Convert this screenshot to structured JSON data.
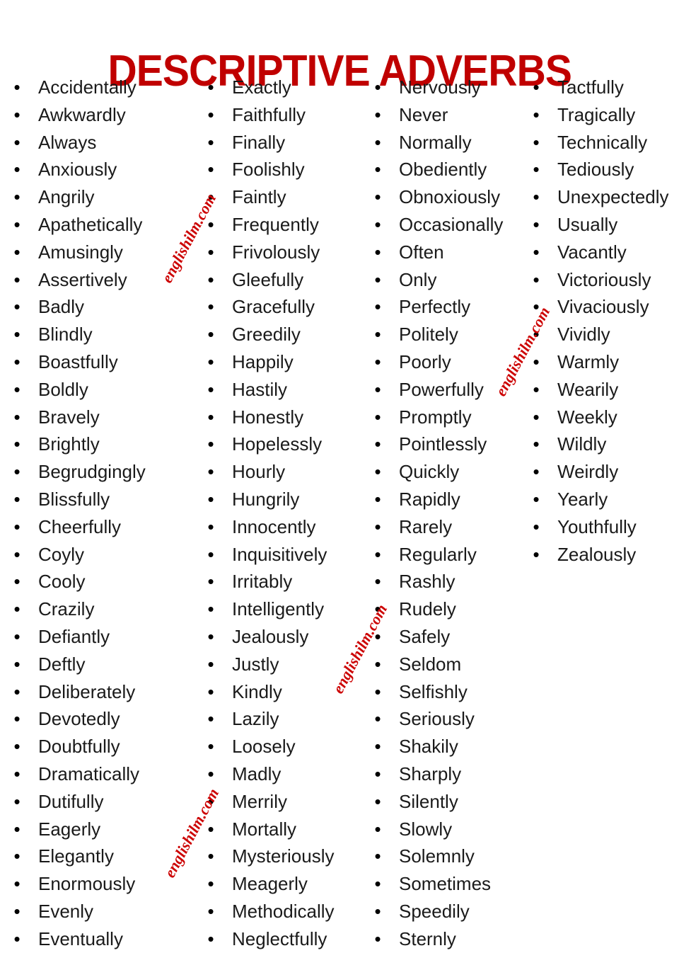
{
  "page": {
    "title": "DESCRIPTIVE ADVERBS",
    "title_color": "#C00000",
    "background_color": "#FFFFFF",
    "text_color": "#1A1A1A",
    "bullet_glyph": "•"
  },
  "watermarks": [
    {
      "text": "englishilm.com",
      "color": "#CC0000"
    },
    {
      "text": "englishilm.com",
      "color": "#CC0000"
    },
    {
      "text": "englishilm.com",
      "color": "#CC0000"
    },
    {
      "text": "englishilm.com",
      "color": "#CC0000"
    }
  ],
  "columns": [
    {
      "id": "column-1",
      "items": [
        "Accidentally",
        "Awkwardly",
        "Always",
        "Anxiously",
        "Angrily",
        "Apathetically",
        "Amusingly",
        "Assertively",
        "Badly",
        "Blindly",
        "Boastfully",
        "Boldly",
        "Bravely",
        "Brightly",
        "Begrudgingly",
        "Blissfully",
        "Cheerfully",
        "Coyly",
        "Cooly",
        "Crazily",
        "Defiantly",
        "Deftly",
        "Deliberately",
        "Devotedly",
        "Doubtfully",
        "Dramatically",
        "Dutifully",
        "Eagerly",
        "Elegantly",
        "Enormously",
        "Evenly",
        "Eventually"
      ]
    },
    {
      "id": "column-2",
      "items": [
        "Exactly",
        "Faithfully",
        "Finally",
        "Foolishly",
        "Faintly",
        "Frequently",
        "Frivolously",
        "Gleefully",
        "Gracefully",
        "Greedily",
        "Happily",
        "Hastily",
        "Honestly",
        "Hopelessly",
        "Hourly",
        "Hungrily",
        "Innocently",
        "Inquisitively",
        "Irritably",
        "Intelligently",
        "Jealously",
        "Justly",
        "Kindly",
        "Lazily",
        "Loosely",
        "Madly",
        "Merrily",
        "Mortally",
        "Mysteriously",
        "Meagerly",
        "Methodically",
        "Neglectfully"
      ]
    },
    {
      "id": "column-3",
      "items": [
        "Nervously",
        "Never",
        "Normally",
        "Obediently",
        "Obnoxiously",
        "Occasionally",
        "Often",
        "Only",
        "Perfectly",
        "Politely",
        "Poorly",
        "Powerfully",
        "Promptly",
        "Pointlessly",
        "Quickly",
        "Rapidly",
        "Rarely",
        "Regularly",
        "Rashly",
        "Rudely",
        "Safely",
        "Seldom",
        "Selfishly",
        "Seriously",
        "Shakily",
        "Sharply",
        "Silently",
        "Slowly",
        "Solemnly",
        "Sometimes",
        "Speedily",
        "Sternly"
      ]
    },
    {
      "id": "column-4",
      "items": [
        "Tactfully",
        "Tragically",
        "Technically",
        "Tediously",
        "Unexpectedly",
        "Usually",
        "Vacantly",
        "Victoriously",
        "Vivaciously",
        "Vividly",
        "Warmly",
        "Wearily",
        "Weekly",
        "Wildly",
        "Weirdly",
        "Yearly",
        "Youthfully",
        "Zealously"
      ]
    }
  ]
}
